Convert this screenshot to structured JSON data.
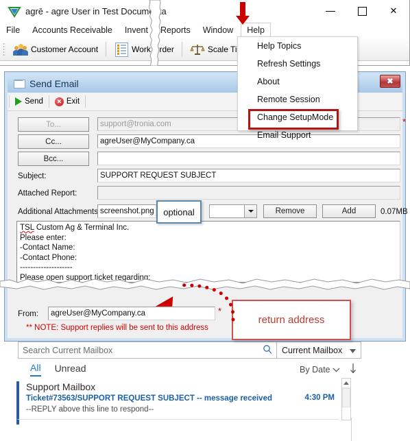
{
  "app": {
    "title": "agrē - agre User in Test Documenta",
    "logo_icon": "agre-triangle-logo",
    "window_controls": {
      "minimize": "minimize-icon",
      "maximize": "maximize-icon",
      "close": "✕"
    },
    "menus": [
      "File",
      "Accounts Receivable",
      "Invent",
      "Reports",
      "Window",
      "Help"
    ],
    "open_menu": "Help",
    "toolbar": [
      {
        "label": "Customer Account",
        "icon": "people-icon"
      },
      {
        "label": "Work Order",
        "icon": "document-list-icon"
      },
      {
        "label": "Scale Tickets",
        "icon": "scale-balance-icon"
      }
    ]
  },
  "help_menu": {
    "items": [
      "Help Topics",
      "Refresh Settings",
      "About",
      "Remote Session",
      "Change SetupMode",
      "Email Support"
    ],
    "highlighted": "Email Support",
    "highlight_color": "#b01616",
    "arrow_color": "#cc0000"
  },
  "dialog": {
    "title": "Send Email",
    "title_icon": "envelope-icon",
    "close_label": "✖",
    "toolbar": [
      {
        "label": "Send",
        "icon": "green-play-icon"
      },
      {
        "label": "Exit",
        "icon": "red-x-circle-icon"
      }
    ],
    "fields": {
      "to_button": "To...",
      "to_value": "support@tronia.com",
      "cc_button": "Cc...",
      "cc_value": "agreUser@MyCompany.ca",
      "bcc_button": "Bcc...",
      "bcc_value": "",
      "subject_label": "Subject:",
      "subject_value": "SUPPORT REQUEST SUBJECT",
      "attached_report_label": "Attached Report:",
      "attached_report_value": "",
      "additional_attachments_label": "Additional Attachments",
      "attachment_value": "screenshot.png",
      "attachment_dropdown_value": "",
      "remove_button": "Remove",
      "add_button": "Add",
      "size_label": "0.07MB"
    },
    "body_lines": [
      "TSL Custom Ag & Terminal Inc.",
      "Please enter:",
      " -Contact Name:",
      " -Contact Phone:",
      " --------------------",
      "Please open support ticket regarding:"
    ],
    "body_misspelled_word": "TSL",
    "from_label": "From:",
    "from_value": "agreUser@MyCompany.ca",
    "required_marker": "*",
    "note": "** NOTE: Support replies will be sent to this address",
    "note_color": "#cc0000"
  },
  "callouts": {
    "optional": "optional",
    "optional_border": "#5b86ad",
    "return_address": "return address",
    "return_border": "#d04f4f",
    "return_text_color": "#c0392b"
  },
  "outlook": {
    "search_placeholder": "Search Current Mailbox",
    "search_icon": "magnifier-icon",
    "scope": "Current Mailbox",
    "scope_icon": "chevron-down-icon",
    "tabs": [
      {
        "label": "All",
        "active": true
      },
      {
        "label": "Unread",
        "active": false
      }
    ],
    "sort_label": "By Date",
    "sort_chevron": "chevron-down-icon",
    "sort_direction_icon": "arrow-down-icon",
    "message": {
      "sender": "Support Mailbox",
      "subject": "Ticket#73563/SUPPORT REQUEST SUBJECT -- message received",
      "preview": "--REPLY above this line to respond--",
      "time": "4:30 PM",
      "accent": "#2c5d9b",
      "subject_color": "#1c5fa8"
    }
  }
}
